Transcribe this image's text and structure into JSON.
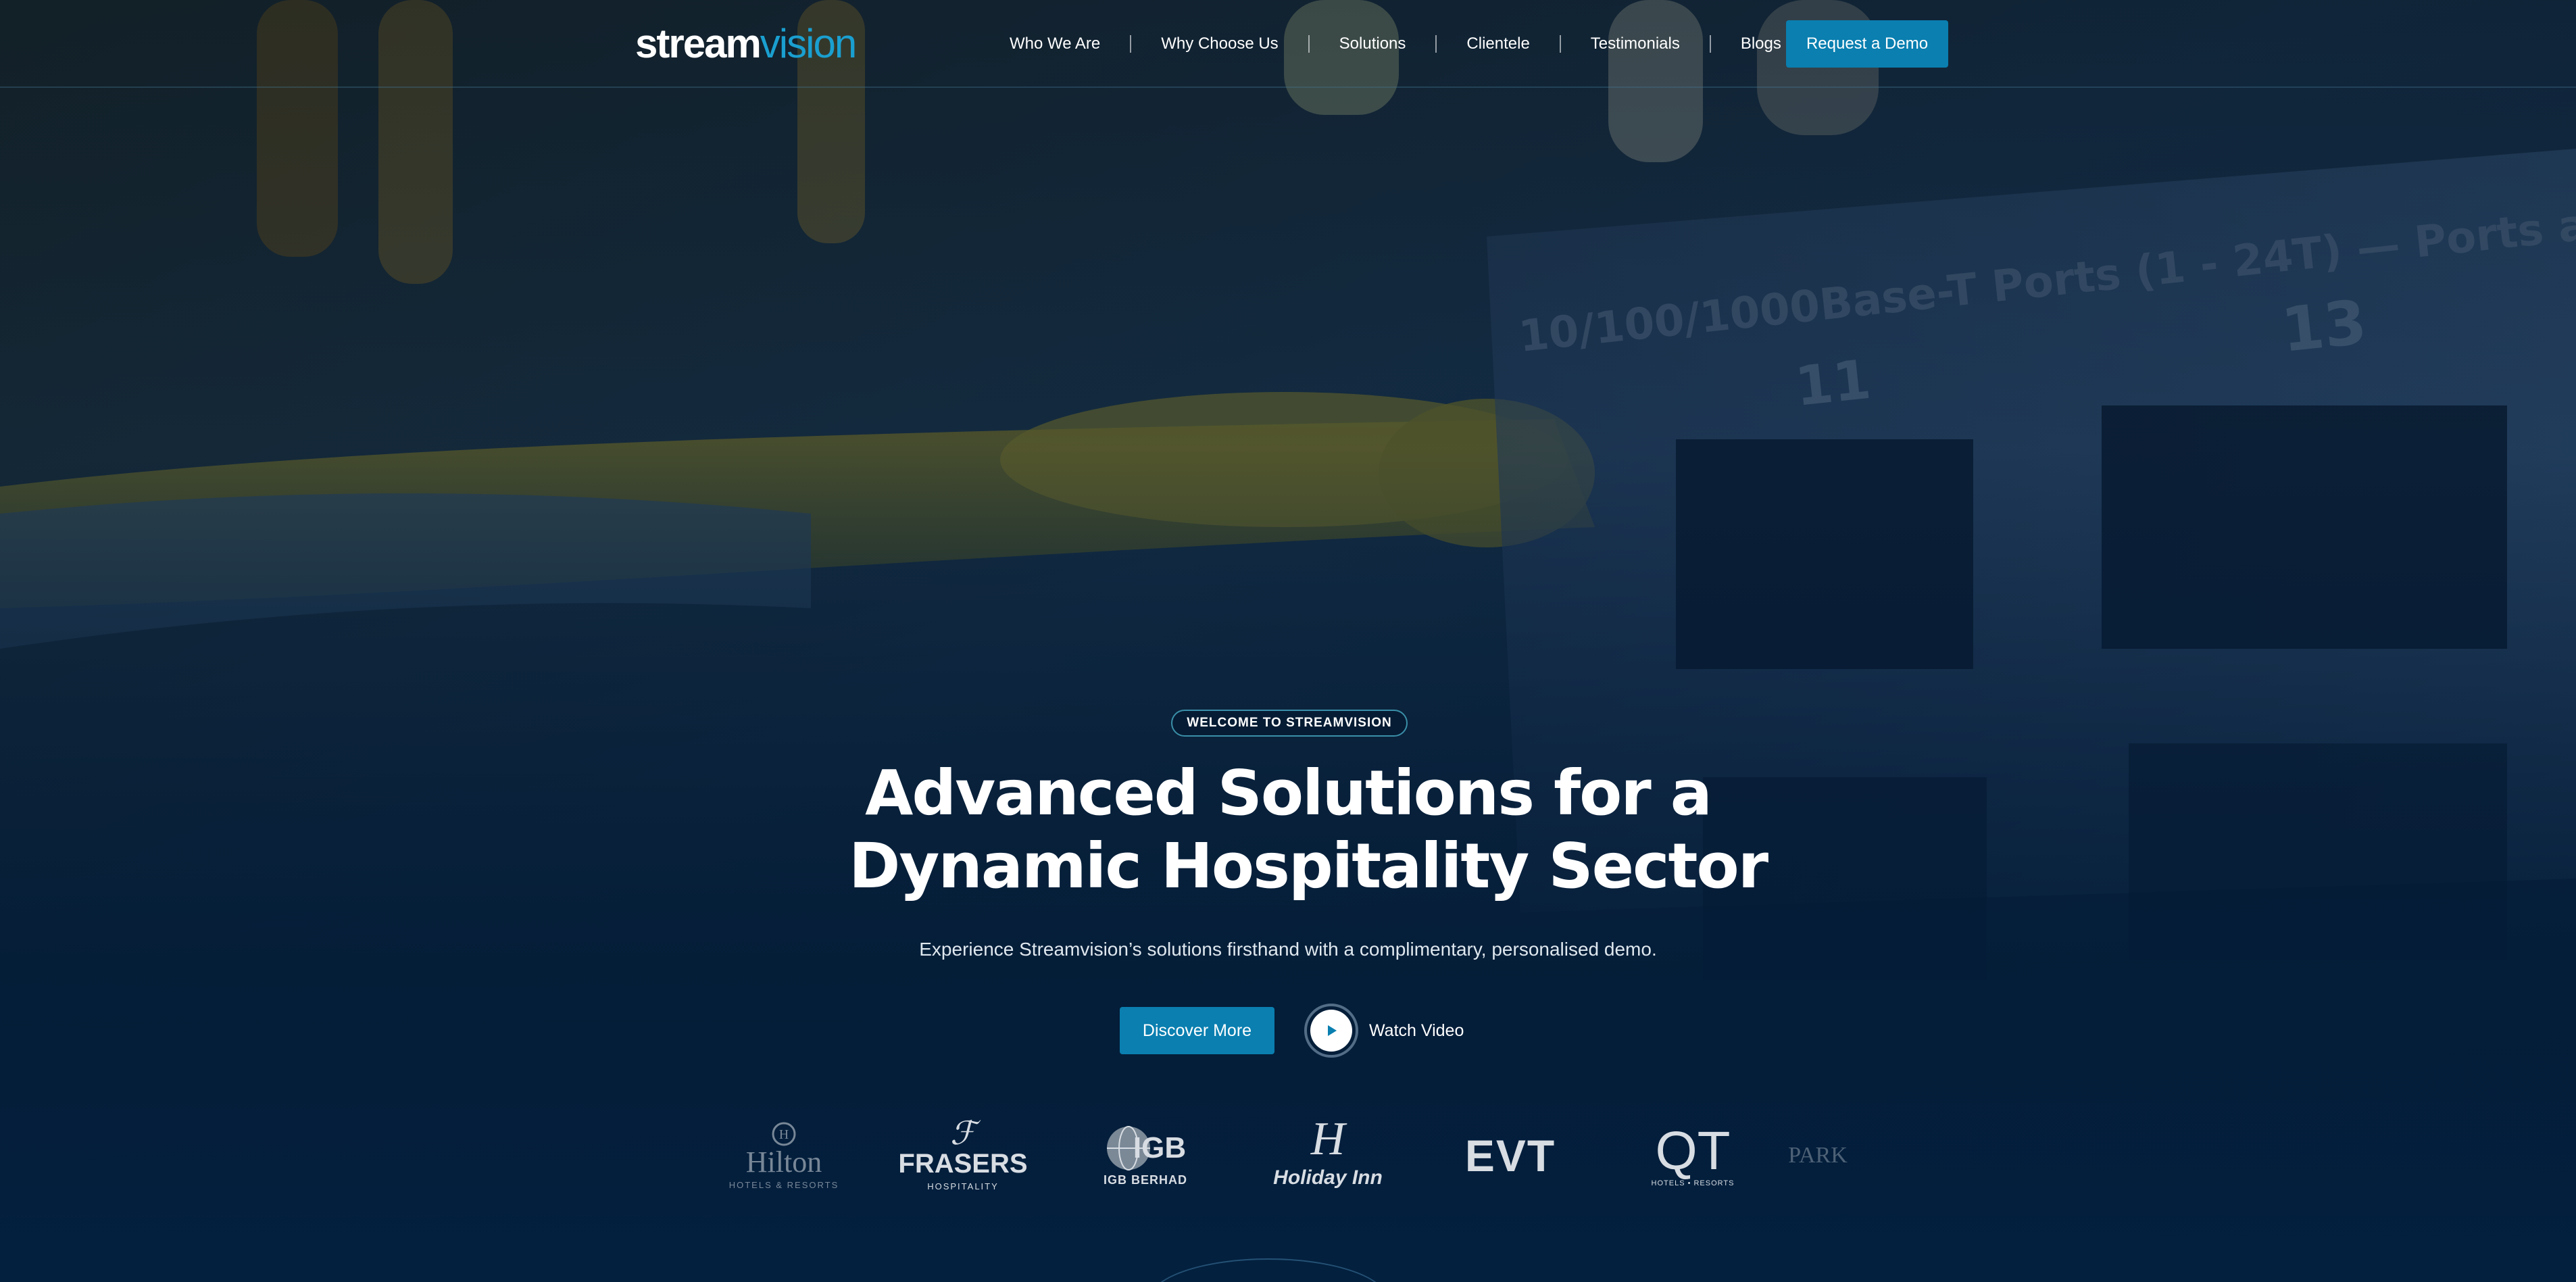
{
  "header": {
    "logo": {
      "part1": "stream",
      "part2": "vision"
    },
    "nav": [
      {
        "label": "Who We Are"
      },
      {
        "label": "Why Choose Us"
      },
      {
        "label": "Solutions"
      },
      {
        "label": "Clientele"
      },
      {
        "label": "Testimonials"
      },
      {
        "label": "Blogs"
      }
    ],
    "cta_label": "Request a Demo"
  },
  "hero": {
    "badge": "WELCOME TO STREAMVISION",
    "title_line1": "Advanced Solutions for a",
    "title_line2": "Dynamic Hospitality Sector",
    "subtitle": "Experience Streamvision’s solutions firsthand with a complimentary, personalised demo.",
    "discover_label": "Discover More",
    "watch_label": "Watch Video"
  },
  "clients": [
    {
      "name": "Hilton",
      "sub": "HOTELS & RESORTS"
    },
    {
      "name": "FRASERS",
      "sub": "HOSPITALITY"
    },
    {
      "name": "IGB",
      "sub": "IGB BERHAD"
    },
    {
      "name": "Holiday Inn",
      "sub": ""
    },
    {
      "name": "EVT",
      "sub": ""
    },
    {
      "name": "QT",
      "sub": "HOTELS • RESORTS"
    },
    {
      "name": "PARK",
      "sub": ""
    }
  ],
  "colors": {
    "accent": "#0a7fb0",
    "logo_blue": "#1a9fd0",
    "navy": "#03203f",
    "text": "#ffffff"
  },
  "icons": {
    "play": "play-icon"
  }
}
